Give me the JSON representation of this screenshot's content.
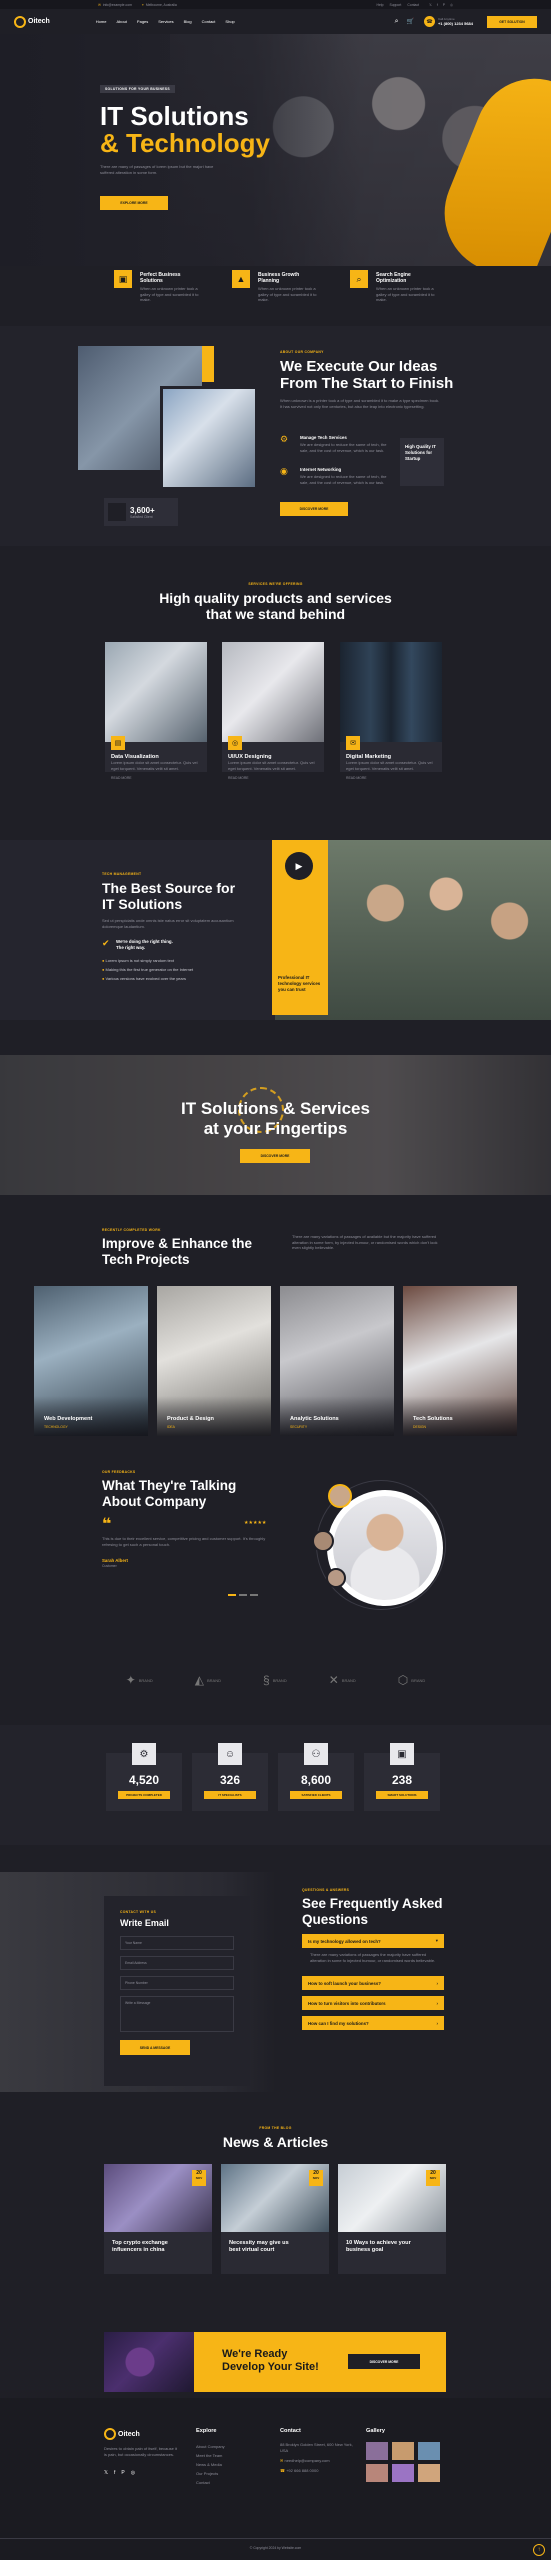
{
  "topbar": {
    "email": "info@example.com",
    "address": "Melbourne, Australia",
    "links": [
      "Help",
      "Support",
      "Contact"
    ]
  },
  "header": {
    "logo": "Oitech",
    "nav": [
      "Home",
      "About",
      "Pages",
      "Services",
      "Blog",
      "Contact",
      "Shop"
    ],
    "phone_label": "Call Anytime",
    "phone": "+1 (800) 1234 5684",
    "cta": "GET SOLUTION"
  },
  "hero": {
    "tag": "SOLUTIONS FOR YOUR BUSINESS",
    "title1": "IT Solutions",
    "title2": "& Technology",
    "text": "There are many of passages of lorem ipsum but the majori have suffered alteration in some form.",
    "btn": "EXPLORE MORE"
  },
  "features": [
    {
      "t1": "Perfect Business",
      "t2": "Solutions",
      "d": "When an unknown printer took a galley of type and scrambled it to make."
    },
    {
      "t1": "Business Growth",
      "t2": "Planning",
      "d": "When an unknown printer took a galley of type and scrambled it to make."
    },
    {
      "t1": "Search Engine",
      "t2": "Optimization",
      "d": "When an unknown printer took a galley of type and scrambled it to make."
    }
  ],
  "about": {
    "kicker": "ABOUT OUR COMPANY",
    "title1": "We Execute Our Ideas",
    "title2": "From The Start to Finish",
    "text": "When unknown is a printer took a of type and scrambled it to make a type specimen book. It has survived not only five centuries, but also the leap into electronic typesetting.",
    "counter": "3,600+",
    "counter_label": "Satisfied Client",
    "item1_title": "Manage Tech Services",
    "item1_text": "We are designed to reduce the same of tech, the sale, and the cost of revenue, which is our task.",
    "item2_title": "Internet Networking",
    "item2_text": "We are designed to reduce the same of tech, the sale, and the cost of revenue, which is our task.",
    "side_box": "High Quality IT Solutions for Startup",
    "btn": "DISCOVER MORE"
  },
  "services": {
    "kicker": "SERVICES WE'RE OFFERING",
    "title1": "High quality products and services",
    "title2": "that we stand behind",
    "items": [
      {
        "title": "Data Visualization",
        "text": "Lorem ipsum dolor sit amet consectetur. Quis vel eget torquent. Venenatis velit sit amet.",
        "more": "READ MORE"
      },
      {
        "title": "UI/UX Designing",
        "text": "Lorem ipsum dolor sit amet consectetur. Quis vel eget torquent. Venenatis velit sit amet.",
        "more": "READ MORE"
      },
      {
        "title": "Digital Marketing",
        "text": "Lorem ipsum dolor sit amet consectetur. Quis vel eget torquent. Venenatis velit sit amet.",
        "more": "READ MORE"
      }
    ]
  },
  "best": {
    "kicker": "TECH MANAGEMENT",
    "title1": "The Best Source for",
    "title2": "IT Solutions",
    "text": "Sed ut perspiciatis unde omnis iste natus error sit voluptatem accusantium doloremque laudantium.",
    "check_title": "We're doing the right thing.",
    "check_sub": "The right way.",
    "bullets": [
      "Lorem ipsum is not simply random text",
      "Making this the first true generator on the Internet",
      "Various versions have evolved over the years"
    ],
    "video_box": "Professional IT technology services you can trust"
  },
  "banner": {
    "title1": "IT Solutions & Services",
    "title2": "at your Fingertips",
    "btn": "DISCOVER MORE"
  },
  "projects": {
    "kicker": "RECENTLY COMPLETED WORK",
    "title1": "Improve & Enhance the",
    "title2": "Tech Projects",
    "text": "There are many variations of passages of available but the majority have suffered alteration in some form, by injected humour, or randomised words which don't look even slightly believable.",
    "items": [
      {
        "title": "Web Development",
        "cat": "TECHNOLOGY"
      },
      {
        "title": "Product & Design",
        "cat": "IDEA"
      },
      {
        "title": "Analytic Solutions",
        "cat": "SECURITY"
      },
      {
        "title": "Tech Solutions",
        "cat": "DESIGN"
      }
    ]
  },
  "testimonial": {
    "kicker": "OUR FEEDBACKS",
    "title1": "What They're Talking",
    "title2": "About Company",
    "stars": "★★★★★",
    "text": "This is due to their excellent service, competitive pricing and customer support. It's throughly refresing to get such a personal touch.",
    "name": "Sarah Albert",
    "role": "Customer"
  },
  "brands": [
    "BRAND",
    "BRAND",
    "BRAND",
    "BRAND",
    "BRAND"
  ],
  "stats": [
    {
      "value": "4,520",
      "label": "PROJECTS COMPLETED"
    },
    {
      "value": "326",
      "label": "IT SPECIALISTS"
    },
    {
      "value": "8,600",
      "label": "SATISFIED CLIENTS"
    },
    {
      "value": "238",
      "label": "SMART SOLUTIONS"
    }
  ],
  "contact": {
    "kicker": "CONTACT WITH US",
    "title": "Write Email",
    "fields": [
      "Your Name",
      "Email Address",
      "Phone Number",
      "Write a Message"
    ],
    "btn": "SEND A MESSAGE"
  },
  "faq": {
    "kicker": "QUESTIONS & ANSWERS",
    "title1": "See Frequently Asked",
    "title2": "Questions",
    "items": [
      "Is my technology allowed on tech?",
      "How to soft launch your business?",
      "How to turn visitors into contributors",
      "How can I find my solutions?"
    ],
    "answer": "There are many variations of passages the majority have suffered alteration in some fo injected humour, or randomised words believable."
  },
  "news": {
    "kicker": "FROM THE BLOG",
    "title": "News & Articles",
    "items": [
      {
        "day": "20",
        "mon": "NOV",
        "title1": "Top crypto exchange",
        "title2": "influencers in china"
      },
      {
        "day": "20",
        "mon": "NOV",
        "title1": "Necessity may give us",
        "title2": "best virtual court"
      },
      {
        "day": "20",
        "mon": "NOV",
        "title1": "10 Ways to achieve your",
        "title2": "business goal"
      }
    ]
  },
  "cta": {
    "title1": "We're Ready",
    "title2": "Develop Your Site!",
    "btn": "DISCOVER MORE"
  },
  "footer": {
    "logo": "Oitech",
    "about": "Desires to obtain pain of itself, because it is pain, but occasionally circumstances.",
    "explore_title": "Explore",
    "explore": [
      "About Company",
      "Meet the Team",
      "News & Media",
      "Our Projects",
      "Contact"
    ],
    "contact_title": "Contact",
    "address": "88 Broklyn Golden Street, 600 New York, USA",
    "email": "needhelp@company.com",
    "phone": "+92 666 888 0000",
    "gallery_title": "Gallery",
    "copyright": "© Copyright 2024 by Website.com"
  },
  "colors": {
    "accent": "#f7b516",
    "bg": "#1f1f26",
    "card": "#2a2a33"
  }
}
